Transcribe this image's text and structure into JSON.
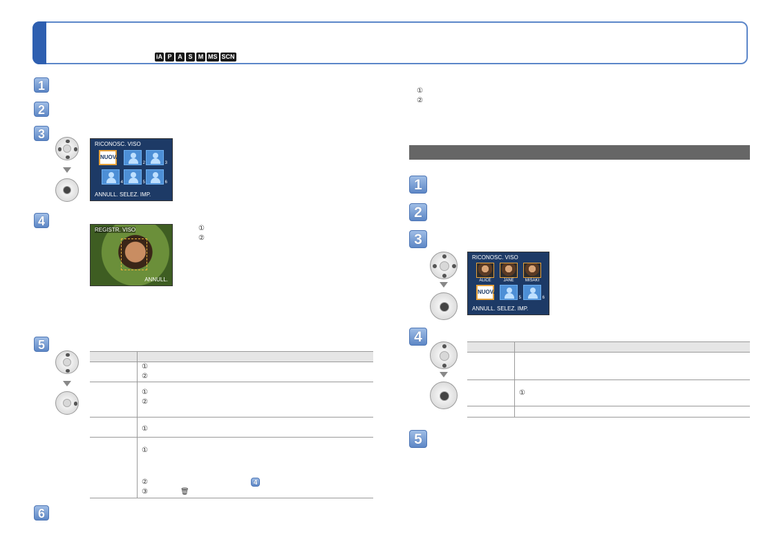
{
  "header": {
    "modes": [
      "iA",
      "P",
      "A",
      "S",
      "M",
      "MS",
      "SCN"
    ]
  },
  "left_steps": [
    "1",
    "2",
    "3",
    "4",
    "5",
    "6"
  ],
  "right_steps": [
    "1",
    "2",
    "3",
    "4",
    "5"
  ],
  "circled": {
    "c1": "①",
    "c2": "②",
    "c3": "③"
  },
  "screen_register_list": {
    "title": "RICONOSC. VISO",
    "new_label": "NUOVA",
    "slots": [
      "2",
      "3",
      "4",
      "5",
      "6"
    ],
    "footer": "ANNULL. SELEZ. IMP."
  },
  "screen_face_capture": {
    "title": "REGISTR. VISO",
    "footer_right": "ANNULL."
  },
  "screen_registered": {
    "title": "RICONOSC. VISO",
    "names": [
      "ALICE",
      "JANE",
      "MISAKI"
    ],
    "new_label": "NUOVA",
    "slots": [
      "2",
      "3",
      "4",
      "5",
      "6"
    ],
    "footer": "ANNULL. SELEZ. IMP."
  },
  "icons": {
    "trash": "trash-icon",
    "step_ref": "4"
  }
}
